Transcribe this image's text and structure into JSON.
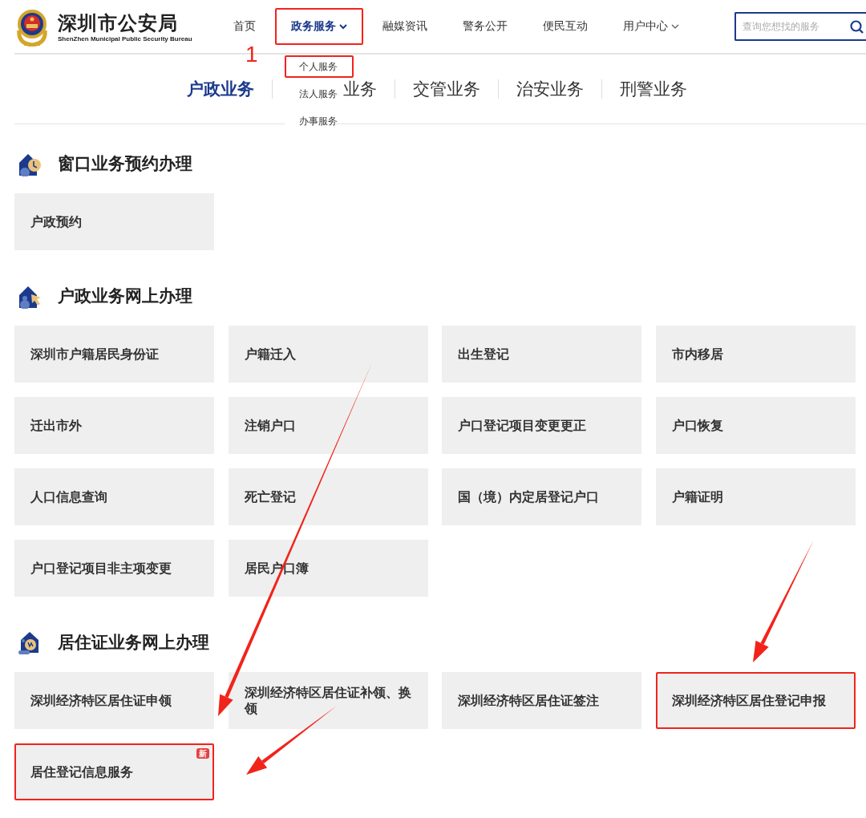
{
  "header": {
    "title": "深圳市公安局",
    "subtitle": "ShenZhen Municipal Public Security Bureau"
  },
  "nav": [
    {
      "label": "首页",
      "selected": false,
      "dropdown": false,
      "highlighted": false
    },
    {
      "label": "政务服务",
      "selected": true,
      "dropdown": true,
      "highlighted": true
    },
    {
      "label": "融媒资讯",
      "selected": false,
      "dropdown": false,
      "highlighted": false
    },
    {
      "label": "警务公开",
      "selected": false,
      "dropdown": false,
      "highlighted": false
    },
    {
      "label": "便民互动",
      "selected": false,
      "dropdown": false,
      "highlighted": false
    },
    {
      "label": "用户中心",
      "selected": false,
      "dropdown": true,
      "highlighted": false
    }
  ],
  "search": {
    "placeholder": "查询您想找的服务"
  },
  "dropdown_menu": [
    {
      "label": "个人服务",
      "highlighted": true
    },
    {
      "label": "法人服务",
      "highlighted": false
    },
    {
      "label": "办事服务",
      "highlighted": false
    }
  ],
  "category_tabs": [
    {
      "label": "户政业务",
      "selected": true
    },
    {
      "label": "业务",
      "selected": false
    },
    {
      "label": "交管业务",
      "selected": false
    },
    {
      "label": "治安业务",
      "selected": false
    },
    {
      "label": "刑警业务",
      "selected": false
    }
  ],
  "sections": [
    {
      "title": "窗口业务预约办理",
      "kind": "clock",
      "items": [
        {
          "label": "户政预约",
          "highlighted": false
        }
      ]
    },
    {
      "title": "户政业务网上办理",
      "kind": "cursor",
      "items": [
        {
          "label": "深圳市户籍居民身份证",
          "highlighted": false
        },
        {
          "label": "户籍迁入",
          "highlighted": false
        },
        {
          "label": "出生登记",
          "highlighted": false
        },
        {
          "label": "市内移居",
          "highlighted": false
        },
        {
          "label": "迁出市外",
          "highlighted": false
        },
        {
          "label": "注销户口",
          "highlighted": false
        },
        {
          "label": "户口登记项目变更更正",
          "highlighted": false
        },
        {
          "label": "户口恢复",
          "highlighted": false
        },
        {
          "label": "人口信息查询",
          "highlighted": false
        },
        {
          "label": "死亡登记",
          "highlighted": false
        },
        {
          "label": "国（境）内定居登记户口",
          "highlighted": false
        },
        {
          "label": "户籍证明",
          "highlighted": false
        },
        {
          "label": "户口登记项目非主项变更",
          "highlighted": false
        },
        {
          "label": "居民户口簿",
          "highlighted": false
        }
      ]
    },
    {
      "title": "居住证业务网上办理",
      "kind": "badge",
      "items": [
        {
          "label": "深圳经济特区居住证申领",
          "highlighted": false
        },
        {
          "label": "深圳经济特区居住证补领、换领",
          "highlighted": false
        },
        {
          "label": "深圳经济特区居住证签注",
          "highlighted": false
        },
        {
          "label": "深圳经济特区居住登记申报",
          "highlighted": true
        },
        {
          "label": "居住登记信息服务",
          "highlighted": true,
          "badge": "新"
        }
      ]
    }
  ],
  "annotation": {
    "step_number": "1"
  }
}
